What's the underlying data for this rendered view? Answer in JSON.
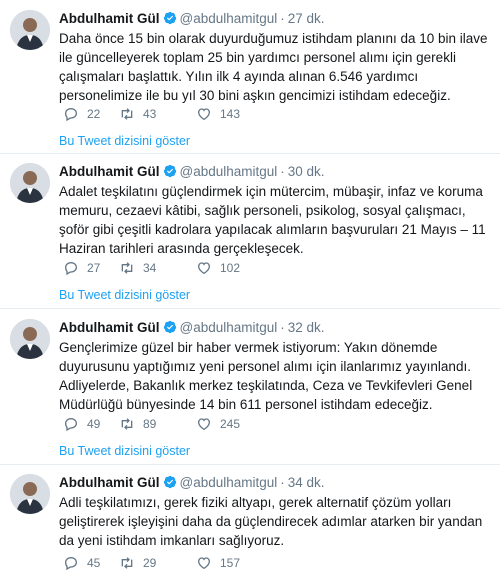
{
  "tweets": [
    {
      "author": "Abdulhamit Gül",
      "handle": "@abdulhamitgul",
      "separator": "·",
      "time": "27 dk.",
      "text": "Daha önce 15 bin olarak duyurduğumuz istihdam planını da 10 bin ilave ile güncelleyerek toplam 25 bin yardımcı personel alımı için gerekli çalışmaları başlattık. Yılın ilk 4 ayında alınan 6.546 yardımcı personelimize ile bu yıl 30 bini aşkın gencimizi istihdam edeceğiz.",
      "replies": "22",
      "retweets": "43",
      "likes": "143",
      "thread_link": "Bu Tweet dizisini göster"
    },
    {
      "author": "Abdulhamit Gül",
      "handle": "@abdulhamitgul",
      "separator": "·",
      "time": "30 dk.",
      "text": "Adalet teşkilatını güçlendirmek için mütercim, mübaşir, infaz ve koruma memuru, cezaevi kâtibi, sağlık personeli, psikolog, sosyal çalışmacı, şoför gibi çeşitli kadrolara yapılacak alımların başvuruları 21 Mayıs – 11 Haziran tarihleri arasında gerçekleşecek.",
      "replies": "27",
      "retweets": "34",
      "likes": "102",
      "thread_link": "Bu Tweet dizisini göster"
    },
    {
      "author": "Abdulhamit Gül",
      "handle": "@abdulhamitgul",
      "separator": "·",
      "time": "32 dk.",
      "text": "Gençlerimize güzel bir haber vermek istiyorum: Yakın dönemde duyurusunu yaptığımız yeni personel alımı için ilanlarımız yayınlandı. Adliyelerde, Bakanlık merkez teşkilatında, Ceza ve Tevkifevleri Genel Müdürlüğü bünyesinde 14 bin 611 personel istihdam edeceğiz.",
      "replies": "49",
      "retweets": "89",
      "likes": "245",
      "thread_link": "Bu Tweet dizisini göster"
    },
    {
      "author": "Abdulhamit Gül",
      "handle": "@abdulhamitgul",
      "separator": "·",
      "time": "34 dk.",
      "text": "Adli teşkilatımızı, gerek fiziki altyapı, gerek alternatif çözüm yolları geliştirerek işleyişini daha da güçlendirecek adımlar atarken bir yandan da yeni istihdam imkanları sağlıyoruz.",
      "replies": "45",
      "retweets": "29",
      "likes": "157",
      "thread_link": ""
    }
  ],
  "icons": {
    "reply": "reply-icon",
    "retweet": "retweet-icon",
    "like": "heart-icon",
    "verified": "verified-badge-icon"
  },
  "colors": {
    "link": "#1da1f2",
    "muted": "#657786",
    "text": "#14171a",
    "divider": "#e6ecf0"
  }
}
